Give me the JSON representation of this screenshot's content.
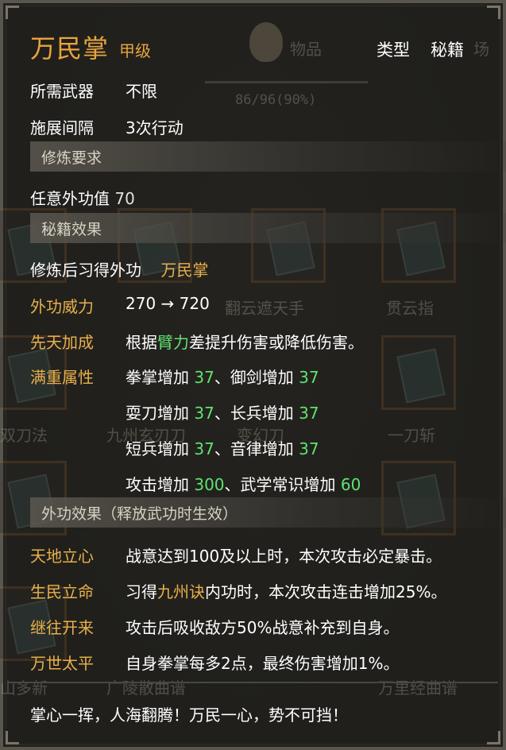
{
  "background": {
    "items_label": "物品",
    "chang_label": "场",
    "count": "86/96(90%)",
    "names": [
      "翻云遮天手",
      "贯云指",
      "双刀法",
      "九州玄刃刀",
      "变幻刀",
      "一刀斩",
      "广陵散曲谱",
      "万里经曲谱",
      "山多新"
    ]
  },
  "header": {
    "title": "万民掌",
    "grade": "甲级",
    "type_label": "类型",
    "type_value": "秘籍"
  },
  "basic": {
    "weapon_label": "所需武器",
    "weapon_value": "不限",
    "interval_label": "施展间隔",
    "interval_value": "3次行动"
  },
  "sections": {
    "requirement": "修炼要求",
    "effect": "秘籍效果",
    "skill_effect": "外功效果（释放武功时生效）"
  },
  "requirement": {
    "text": "任意外功值",
    "value": "70"
  },
  "effect": {
    "learn_label": "修炼后习得外功",
    "learn_value": "万民掌",
    "power_label": "外功威力",
    "power_value": "270 → 720",
    "innate_label": "先天加成",
    "innate_pre": "根据",
    "innate_hl": "臂力",
    "innate_post": "差提升伤害或降低伤害。",
    "full_label": "满重属性",
    "attrs": [
      {
        "a_name": "拳掌增加 ",
        "a_val": "37",
        "sep": "、",
        "b_name": "御剑增加 ",
        "b_val": "37"
      },
      {
        "a_name": "耍刀增加 ",
        "a_val": "37",
        "sep": "、",
        "b_name": "长兵增加 ",
        "b_val": "37"
      },
      {
        "a_name": "短兵增加 ",
        "a_val": "37",
        "sep": "、",
        "b_name": "音律增加 ",
        "b_val": "37"
      },
      {
        "a_name": "攻击增加 ",
        "a_val": "300",
        "sep": "、",
        "b_name": "武学常识增加 ",
        "b_val": "60"
      }
    ]
  },
  "skill_effects": [
    {
      "label": "天地立心",
      "pre": "战意达到100及以上时，本次攻击必定暴击。",
      "hl": "",
      "post": ""
    },
    {
      "label": "生民立命",
      "pre": "习得",
      "hl": "九州诀",
      "post": "内功时，本次攻击连击增加25%。"
    },
    {
      "label": "继往开来",
      "pre": "攻击后吸收敌方50%战意补充到自身。",
      "hl": "",
      "post": ""
    },
    {
      "label": "万世太平",
      "pre": "自身拳掌每多2点，最终伤害增加1%。",
      "hl": "",
      "post": ""
    }
  ],
  "quote": "掌心一挥，人海翻腾！万民一心，势不可挡！",
  "colors": {
    "title": "#e8a53c",
    "label_gold": "#e8b04a",
    "value_green": "#5ee36e",
    "frame": "#5a564e"
  }
}
